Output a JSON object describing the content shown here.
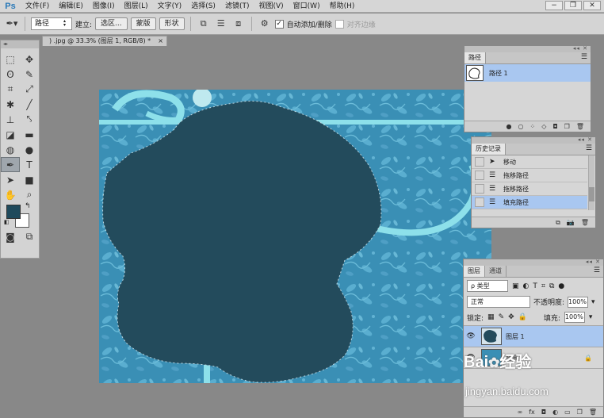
{
  "app": {
    "logo": "Ps"
  },
  "menu": [
    "文件(F)",
    "编辑(E)",
    "图像(I)",
    "图层(L)",
    "文字(Y)",
    "选择(S)",
    "滤镜(T)",
    "视图(V)",
    "窗口(W)",
    "帮助(H)"
  ],
  "window_buttons": [
    "−",
    "❐",
    "✕"
  ],
  "options_bar": {
    "mode_select": "路径",
    "make_label": "建立:",
    "selection_btn": "选区...",
    "mask_btn": "蒙版",
    "shape_btn": "形状",
    "auto_add_delete": "自动添加/删除",
    "align_edges": "对齐边缘"
  },
  "document": {
    "tab_title": ") .jpg @ 33.3% (图层 1, RGB/8) *",
    "close": "×"
  },
  "colors": {
    "foreground": "#1f4a5c",
    "background": "#ffffff",
    "selection_highlight": "#a9c7f0",
    "path_fill": "#234b5c",
    "canvas_bg": "#3a8fb5"
  },
  "paths_panel": {
    "tab": "路径",
    "items": [
      {
        "name": "路径 1"
      }
    ]
  },
  "history_panel": {
    "tab": "历史记录",
    "items": [
      {
        "label": "移动",
        "icon": "move-tool-icon"
      },
      {
        "label": "拖移路径",
        "icon": "history-state-icon"
      },
      {
        "label": "拖移路径",
        "icon": "history-state-icon"
      },
      {
        "label": "填充路径",
        "icon": "history-state-icon"
      }
    ]
  },
  "layers_panel": {
    "tabs": [
      "图层",
      "通道"
    ],
    "filter_kind": "ρ 类型",
    "blend_mode": "正常",
    "opacity_label": "不透明度:",
    "opacity_value": "100%",
    "lock_label": "锁定:",
    "fill_label": "填充:",
    "fill_value": "100%",
    "layers": [
      {
        "name": "图层 1",
        "selected": true
      },
      {
        "name": "背景",
        "selected": false,
        "locked": true
      }
    ]
  },
  "watermark": {
    "brand": "Bai",
    "brand2": "经验",
    "url": "jingyan.baidu.com"
  }
}
